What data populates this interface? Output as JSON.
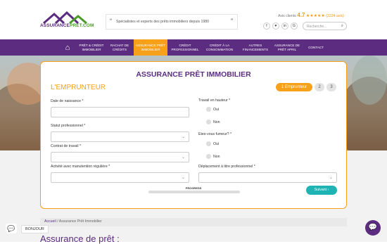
{
  "header": {
    "logo_text_1": "ASSURANCE",
    "logo_text_2": "PRET.COM",
    "tagline": "Spécialistes et experts des prêts immobiliers depuis 1980",
    "avis_label": "Avis clients",
    "avis_score": "4.7",
    "avis_stars": "★★★★★",
    "avis_count": "(2224 avis)",
    "social": [
      "f",
      "♥",
      "in",
      "G"
    ],
    "search_placeholder": "Recherche..."
  },
  "nav": {
    "items": [
      {
        "label": "PRÊT & CRÉDIT IMMOBILIER"
      },
      {
        "label": "RACHAT DE CRÉDITS"
      },
      {
        "label": "ASSURANCE PRÊT IMMOBILIER"
      },
      {
        "label": "CRÉDIT PROFESSIONNEL"
      },
      {
        "label": "CRÉDIT À LA CONSOMMATION"
      },
      {
        "label": "AUTRES FINANCEMENTS"
      },
      {
        "label": "ASSURANCE DE PRÊT APRIL"
      },
      {
        "label": "CONTACT"
      }
    ]
  },
  "form": {
    "title": "ASSURANCE PRÊT IMMOBILIER",
    "section": "L'EMPRUNTEUR",
    "steps": [
      "1 Emprunteur",
      "2",
      "3"
    ],
    "fields": {
      "birth": "Date de naissance *",
      "status": "Statut professionnel *",
      "contract": "Contrat de travail *",
      "handling": "Activité avec manutention régulière *",
      "height": "Travail en hauteur *",
      "smoker": "Etes-vous fumeur? *",
      "travel": "Déplacement à titre professionnel *"
    },
    "oui": "Oui",
    "non": "Non",
    "progress_label": "PROGRESS",
    "progress_value": 0,
    "next_button": "Suivant ›"
  },
  "breadcrumb": {
    "home": "Accueil",
    "sep": "/",
    "current": "Assurance Prêt Immobilier"
  },
  "page_heading": "Assurance de prêt :",
  "chat": {
    "bonjour": "BONJOUR"
  },
  "colors": {
    "brand": "#5b2c7f",
    "accent": "#f7a11a",
    "button": "#1fb3b3"
  }
}
